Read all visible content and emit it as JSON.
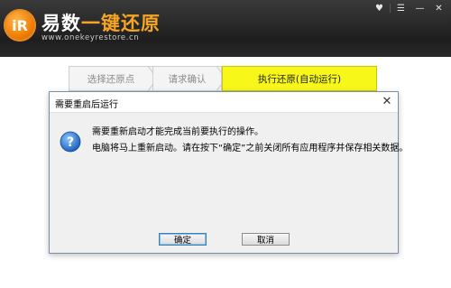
{
  "app": {
    "logo_text": "iR",
    "title_part1": "易数",
    "title_part2": "一键还原",
    "url": "www.onekeyrestore.cn"
  },
  "window_controls": {
    "icons": [
      "skin-icon",
      "menu-icon",
      "minimize-icon",
      "close-icon"
    ]
  },
  "steps": [
    {
      "label": "选择还原点",
      "active": false
    },
    {
      "label": "请求确认",
      "active": false
    },
    {
      "label": "执行还原(自动运行)",
      "active": true
    }
  ],
  "dialog": {
    "title": "需要重启后运行",
    "message_line1": "需要重新启动才能完成当前要执行的操作。",
    "message_line2": "电脑将马上重新启动。请在按下“确定”之前关闭所有应用程序并保存相关数据。",
    "ok_label": "确定",
    "cancel_label": "取消"
  },
  "colors": {
    "header_bg": "#252525",
    "active_step": "#f7f71a",
    "accent": "#f6a623"
  }
}
